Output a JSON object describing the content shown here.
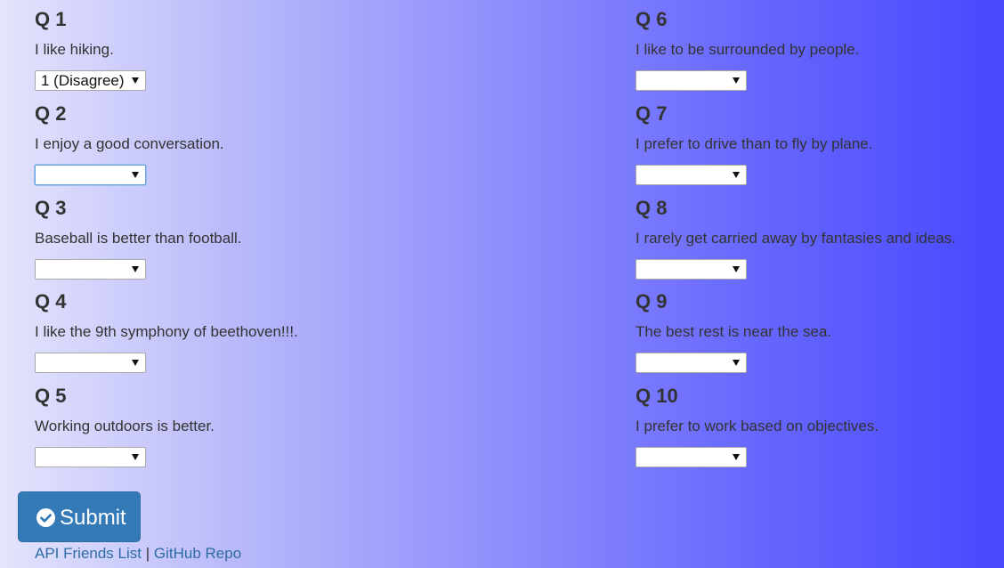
{
  "questions": [
    {
      "title": "Q 1",
      "text": "I like hiking.",
      "selected": "1 (Disagree)"
    },
    {
      "title": "Q 2",
      "text": "I enjoy a good conversation.",
      "selected": ""
    },
    {
      "title": "Q 3",
      "text": "Baseball is better than football.",
      "selected": ""
    },
    {
      "title": "Q 4",
      "text": "I like the 9th symphony of beethoven!!!.",
      "selected": ""
    },
    {
      "title": "Q 5",
      "text": "Working outdoors is better.",
      "selected": ""
    },
    {
      "title": "Q 6",
      "text": "I like to be surrounded by people.",
      "selected": ""
    },
    {
      "title": "Q 7",
      "text": "I prefer to drive than to fly by plane.",
      "selected": ""
    },
    {
      "title": "Q 8",
      "text": "I rarely get carried away by fantasies and ideas.",
      "selected": ""
    },
    {
      "title": "Q 9",
      "text": "The best rest is near the sea.",
      "selected": ""
    },
    {
      "title": "Q 10",
      "text": "I prefer to work based on objectives.",
      "selected": ""
    }
  ],
  "submit": {
    "label": "Submit",
    "icon": "check-circle-icon",
    "color": "#337ab7"
  },
  "footer": {
    "link1": "API Friends List",
    "separator": "|",
    "link2": "GitHub Repo",
    "link_color": "#2e6da4"
  },
  "colors": {
    "background_start": "#e4e4fd",
    "background_end": "#4848fe",
    "text": "#333333",
    "focus_ring": "#6a9fe0"
  }
}
